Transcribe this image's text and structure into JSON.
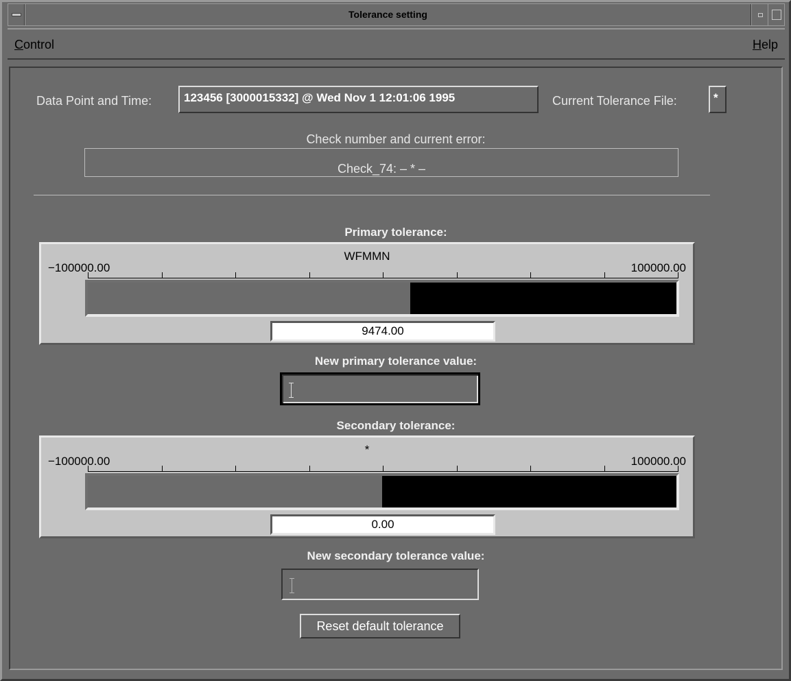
{
  "window": {
    "title": "Tolerance setting"
  },
  "menubar": {
    "control": "Control",
    "help": "Help"
  },
  "header": {
    "data_point_label": "Data Point and Time:",
    "data_point_value": "123456 [3000015332] @ Wed Nov  1 12:01:06 1995",
    "tolerance_file_label": "Current Tolerance File:",
    "tolerance_file_value": "*"
  },
  "check": {
    "title": "Check number and current error:",
    "value": "Check_74: – * –"
  },
  "primary": {
    "title": "Primary tolerance:",
    "scale_name": "WFMMN",
    "min": "−100000.00",
    "max": "100000.00",
    "value": "9474.00",
    "value_num": 9474.0,
    "min_num": -100000.0,
    "max_num": 100000.0
  },
  "primary_input": {
    "label": "New primary tolerance value:",
    "value": ""
  },
  "secondary": {
    "title": "Secondary tolerance:",
    "scale_name": "*",
    "min": "−100000.00",
    "max": "100000.00",
    "value": "0.00",
    "value_num": 0.0,
    "min_num": -100000.0,
    "max_num": 100000.0
  },
  "secondary_input": {
    "label": "New secondary tolerance value:",
    "value": ""
  },
  "reset_button": "Reset default tolerance",
  "colors": {
    "background": "#6b6b6b",
    "panel": "#c4c4c4",
    "slider_fill": "#000000"
  }
}
